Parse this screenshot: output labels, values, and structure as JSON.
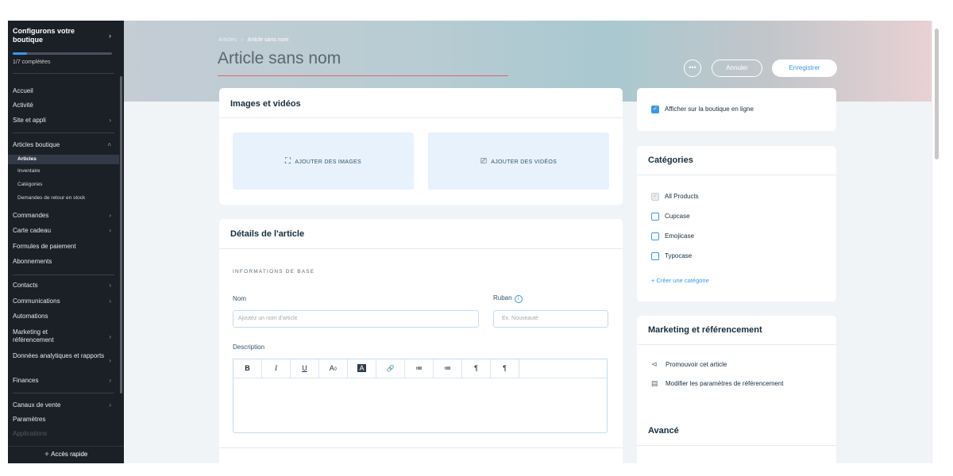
{
  "sidebar": {
    "setup_title": "Configurons votre boutique",
    "setup_progress": "1/7 complétées",
    "setup_progress_fraction": 0.14,
    "items_top": [
      {
        "label": "Accueil",
        "chevron": false
      },
      {
        "label": "Activité",
        "chevron": false
      },
      {
        "label": "Site et appli",
        "chevron": true
      }
    ],
    "store_section": {
      "label": "Articles boutique",
      "subitems": [
        "Articles",
        "Inventaire",
        "Catégories",
        "Demandes de retour en stock"
      ]
    },
    "items_mid": [
      {
        "label": "Commandes",
        "chevron": true
      },
      {
        "label": "Carte cadeau",
        "chevron": true
      },
      {
        "label": "Formules de paiement",
        "chevron": false
      },
      {
        "label": "Abonnements",
        "chevron": false
      }
    ],
    "items_low": [
      {
        "label": "Contacts",
        "chevron": true
      },
      {
        "label": "Communications",
        "chevron": true
      },
      {
        "label": "Automations",
        "chevron": false
      },
      {
        "label": "Marketing et référencement",
        "chevron": true
      },
      {
        "label": "Données analytiques et rapports",
        "chevron": true
      },
      {
        "label": "Finances",
        "chevron": true
      }
    ],
    "items_bottom": [
      {
        "label": "Canaux de vente",
        "chevron": true
      },
      {
        "label": "Paramètres",
        "chevron": false
      }
    ],
    "faded_item": "Applications",
    "quick_access": "Accès rapide"
  },
  "header": {
    "breadcrumb": [
      "Articles",
      "Article sans nom"
    ],
    "title": "Article sans nom",
    "more_label": "•••",
    "cancel_label": "Annuler",
    "save_label": "Enregistrer"
  },
  "media": {
    "title": "Images et vidéos",
    "add_images": "AJOUTER DES IMAGES",
    "add_videos": "AJOUTER DES VIDÉOS"
  },
  "details": {
    "title": "Détails de l'article",
    "section_label": "INFORMATIONS DE BASE",
    "name_label": "Nom",
    "name_placeholder": "Ajoutez un nom d'article",
    "ribbon_label": "Ruban",
    "ribbon_placeholder": "Ex. Nouveauté",
    "description_label": "Description",
    "toolbar": [
      "B",
      "I",
      "U",
      "A",
      "A",
      "🔗",
      "≔",
      "≔",
      "¶",
      "¶"
    ]
  },
  "visibility": {
    "label": "Afficher sur la boutique en ligne",
    "checked": true
  },
  "categories": {
    "title": "Catégories",
    "items": [
      {
        "label": "All Products",
        "checked": true,
        "disabled": true
      },
      {
        "label": "Cupcase",
        "checked": false,
        "disabled": false
      },
      {
        "label": "Emojicase",
        "checked": false,
        "disabled": false
      },
      {
        "label": "Typocase",
        "checked": false,
        "disabled": false
      }
    ],
    "create_link": "+ Créer une catégorie"
  },
  "marketing": {
    "title": "Marketing et référencement",
    "promote": "Promouvoir cet article",
    "seo": "Modifier les paramètres de référencement"
  },
  "advanced": {
    "title": "Avancé"
  },
  "colors": {
    "accent": "#3899ec",
    "sidebar_bg": "#1b1f26",
    "title_underline": "#e0656a"
  }
}
